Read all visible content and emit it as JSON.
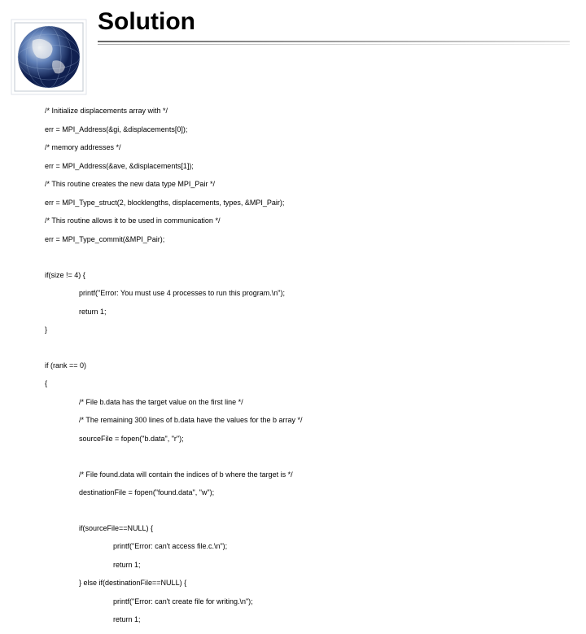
{
  "title": "Solution",
  "code": {
    "l1": "/* Initialize displacements array with */",
    "l2": "err = MPI_Address(&gi, &displacements[0]);",
    "l3": "/* memory addresses */",
    "l4": "err = MPI_Address(&ave, &displacements[1]);",
    "l5": "/* This routine creates the new data type MPI_Pair */",
    "l6": "err = MPI_Type_struct(2, blocklengths, displacements, types, &MPI_Pair);",
    "l7": "/* This routine allows it to be used in communication */",
    "l8": "err = MPI_Type_commit(&MPI_Pair);",
    "l9": "if(size != 4) {",
    "l10": "printf(\"Error: You must use 4 processes to run this program.\\n\");",
    "l11": "return 1;",
    "l12": "}",
    "l13": "if (rank == 0)",
    "l14": "{",
    "l15": "/* File b.data has the target value on the first line */",
    "l16": "/* The remaining 300 lines of b.data have the values for the b array */",
    "l17": "sourceFile = fopen(\"b.data\", \"r\");",
    "l18": "/* File found.data will contain the indices of b where the target is */",
    "l19": "destinationFile = fopen(\"found.data\", \"w\");",
    "l20": "if(sourceFile==NULL) {",
    "l21": "printf(\"Error: can't access file.c.\\n\");",
    "l22": "return 1;",
    "l23": "} else if(destinationFile==NULL) {",
    "l24": "printf(\"Error: can't create file for writing.\\n\");",
    "l25": "return 1;"
  }
}
